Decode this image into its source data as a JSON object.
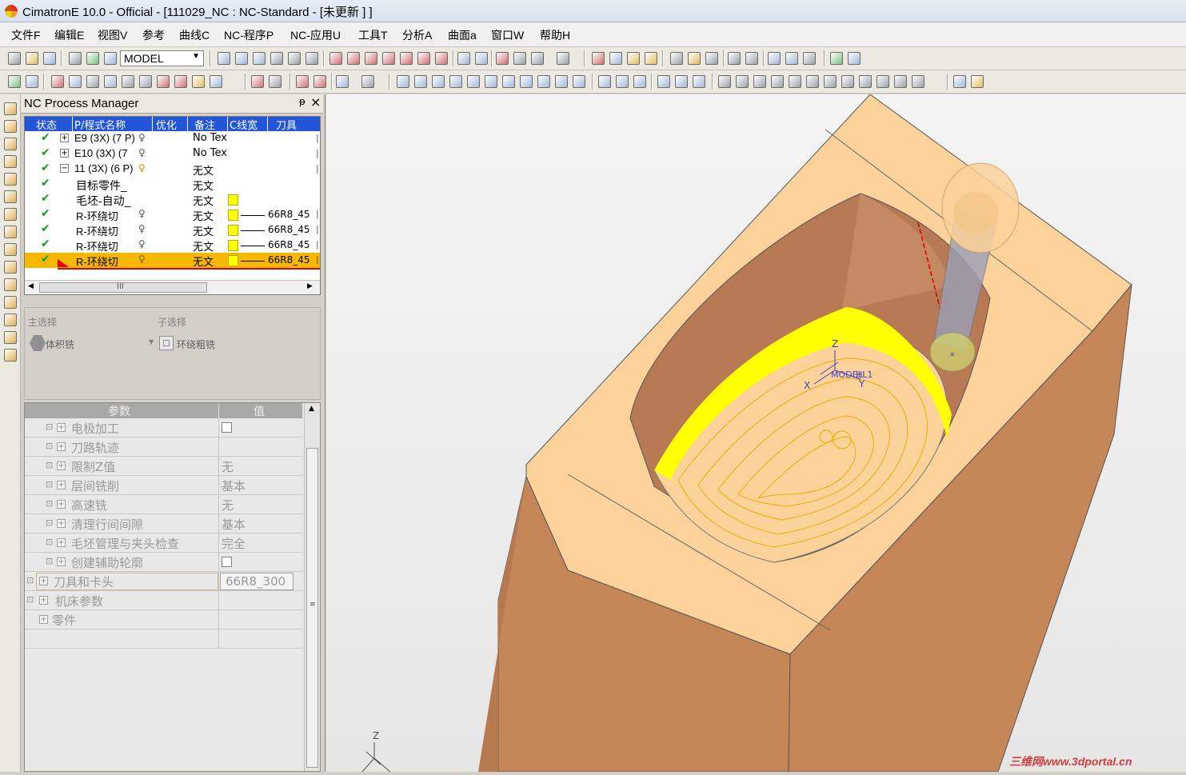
{
  "window": {
    "title": "CimatronE 10.0 - Official - [111029_NC : NC-Standard - [未更新 ] ]"
  },
  "menu": [
    "文件F",
    "编辑E",
    "视图V",
    "参考",
    "曲线C",
    "NC-程序P",
    "NC-应用U",
    "工具T",
    "分析A",
    "曲面a",
    "窗口W",
    "帮助H"
  ],
  "toolbar": {
    "model_select": "MODEL"
  },
  "panel": {
    "title": "NC Process Manager",
    "pin": "ᵽ",
    "close": "×"
  },
  "tree": {
    "headers": [
      "状态",
      "P/程式名称",
      "优化",
      "备注",
      "C线宽",
      "刀具"
    ],
    "rows": [
      {
        "name": "E9 (3X) (7 P)",
        "note": "No Tex",
        "tool": ""
      },
      {
        "name": "E10 (3X) (7",
        "note": "No Tex",
        "tool": ""
      },
      {
        "name": "11 (3X) (6 P)",
        "note": "无文",
        "tool": ""
      },
      {
        "name": "目标零件_",
        "note": "无文",
        "tool": ""
      },
      {
        "name": "毛坯-自动_",
        "note": "无文",
        "tool": ""
      },
      {
        "name": "R-环绕切",
        "note": "无文",
        "tool": "66R8_45"
      },
      {
        "name": "R-环绕切",
        "note": "无文",
        "tool": "66R8_45"
      },
      {
        "name": "R-环绕切",
        "note": "无文",
        "tool": "66R8_45"
      },
      {
        "name": "R-环绕切",
        "note": "无文",
        "tool": "66R8_45"
      }
    ],
    "scroll_mid": "III"
  },
  "selection": {
    "main_label": "主选择",
    "sub_label": "子选择",
    "main_value": "体积铣",
    "sub_value": "环绕粗铣"
  },
  "params": {
    "head_name": "参数",
    "head_value": "值",
    "rows": [
      {
        "name": "电极加工",
        "value": ""
      },
      {
        "name": "刀路轨迹",
        "value": ""
      },
      {
        "name": "限制Z值",
        "value": "无"
      },
      {
        "name": "层间铣削",
        "value": "基本"
      },
      {
        "name": "高速铣",
        "value": "无"
      },
      {
        "name": "清理行间间隙",
        "value": "基本"
      },
      {
        "name": "毛坯管理与夹头检查",
        "value": "完全"
      },
      {
        "name": "创建辅助轮廓",
        "value": ""
      },
      {
        "name": "刀具和卡头",
        "value": "66R8_300"
      },
      {
        "name": "机床参数",
        "value": ""
      },
      {
        "name": "零件",
        "value": ""
      }
    ]
  },
  "viewport": {
    "ucs_label": "MODEL",
    "ucs_label2": "HL1",
    "axis_z": "Z",
    "axis_x": "X",
    "axis_y": "Y",
    "corner_z": "Z"
  },
  "watermark": "三维网www.3dportal.cn",
  "colors": {
    "selection_row": "#f6b800",
    "tree_header": "#2255d8",
    "part_light": "#fbd29a",
    "part_dark": "#c58658",
    "highlight": "#ffff00"
  }
}
